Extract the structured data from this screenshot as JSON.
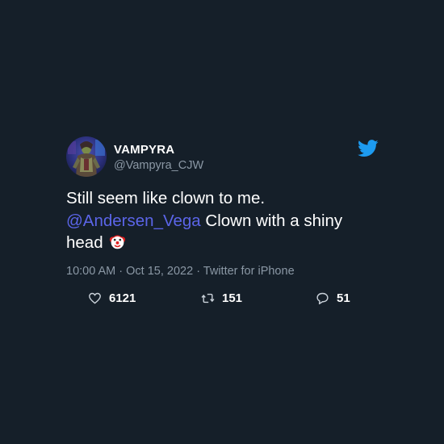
{
  "tweet": {
    "display_name": "VAMPYRA",
    "handle": "@Vampyra_CJW",
    "text_line1": "Still seem like clown to me.",
    "mention": "@Andersen_Vega",
    "text_after_mention": " Clown with a shiny head",
    "emoji": "clown-face-emoji",
    "meta": "10:00 AM · Oct 15, 2022 · Twitter for iPhone",
    "likes": "6121",
    "retweets": "151",
    "replies": "51"
  },
  "icons": {
    "brand": "twitter-bird-icon",
    "like": "heart-icon",
    "retweet": "retweet-icon",
    "reply": "reply-icon"
  },
  "colors": {
    "background": "#151f29",
    "text": "#ffffff",
    "muted": "#8b98a5",
    "mention": "#5b65e8",
    "twitter_blue": "#1d9bf0"
  }
}
